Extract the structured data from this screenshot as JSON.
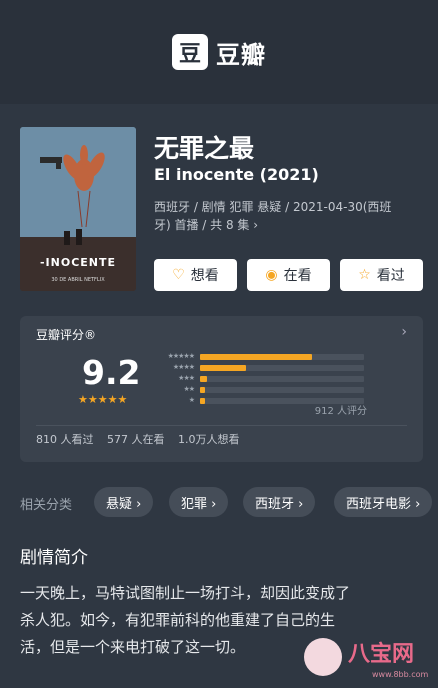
{
  "app": {
    "logo_glyph": "豆",
    "logo_text": "豆瓣"
  },
  "movie": {
    "title_cn": "无罪之最",
    "title_original": "El inocente (2021)",
    "meta_line1": "西班牙 / 剧情 犯罪 悬疑 / 2021-04-30(西班",
    "meta_line2": "牙) 首播 / 共 8 集 ›",
    "poster_title": "-INOCENTE",
    "poster_sub": "30 DE ABRIL  NETFLIX"
  },
  "actions": [
    {
      "label": "想看",
      "icon": "heart-icon",
      "glyph": "♡"
    },
    {
      "label": "在看",
      "icon": "watching-icon",
      "glyph": "◉"
    },
    {
      "label": "看过",
      "icon": "star-icon",
      "glyph": "☆"
    }
  ],
  "rating": {
    "label": "豆瓣评分®",
    "score": "9.2",
    "stars_glyph": "★★★★★",
    "count": "912 人评分",
    "distribution": [
      {
        "stars": "★★★★★",
        "fraction": 0.68
      },
      {
        "stars": "★★★★",
        "fraction": 0.28
      },
      {
        "stars": "★★★",
        "fraction": 0.04
      },
      {
        "stars": "★★",
        "fraction": 0.03
      },
      {
        "stars": "★",
        "fraction": 0.03
      }
    ],
    "stats": [
      "810 人看过",
      "577 人在看",
      "1.0万人想看"
    ]
  },
  "tags": {
    "label": "相关分类",
    "items": [
      "悬疑 ›",
      "犯罪 ›",
      "西班牙 ›",
      "西班牙电影 ›"
    ]
  },
  "synopsis": {
    "title": "剧情简介",
    "line1": "一天晚上，马特试图制止一场打斗，却因此变成了",
    "line2": "杀人犯。如今，有犯罪前科的他重建了自己的生",
    "line3": "活，但是一个来电打破了这一切。"
  },
  "watermark": {
    "text": "八宝网",
    "url": "www.8bb.com"
  },
  "colors": {
    "accent": "#f5a623",
    "background": "#2f3742"
  }
}
